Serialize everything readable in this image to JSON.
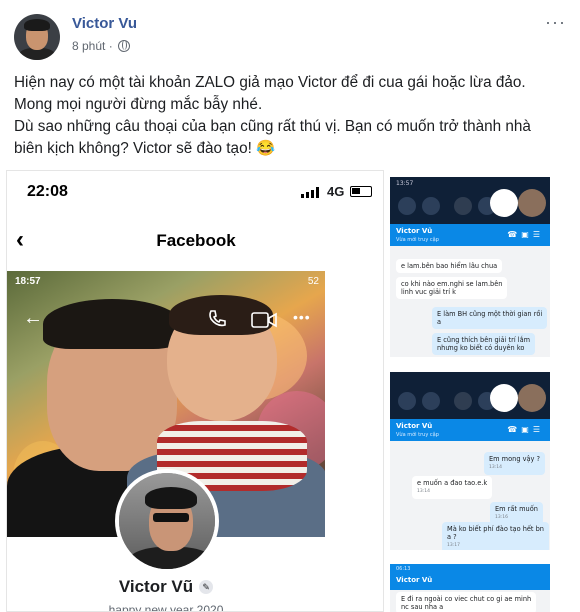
{
  "post": {
    "author": "Victor Vu",
    "time": "8 phút ·",
    "more": "···",
    "text_lines": [
      "Hiện nay có một tài khoản ZALO giả mạo Victor để đi cua gái hoặc lừa đảo.",
      "Mong mọi người đừng mắc bẫy nhé.",
      "Dù sao những câu thoại của bạn cũng rất thú vị. Bạn có muốn trở thành nhà",
      "biên kịch không? Victor sẽ đào tạo! 😂"
    ]
  },
  "phone": {
    "time": "22:08",
    "network": "4G",
    "title": "Facebook",
    "photo_status_time": "18:57",
    "photo_status_right": "52",
    "profile_name": "Victor Vũ",
    "bio": "happy new year 2020"
  },
  "zalo1": {
    "status": "13:57",
    "contact": "Victor Vũ",
    "sub": "Vừa mới truy cập",
    "messages": [
      {
        "dir": "in",
        "text": "e lam.bên bao hiểm lâu chua"
      },
      {
        "dir": "in",
        "text": "co khi nào em.nghi se lam.bên\nlinh vuc giải trí k"
      },
      {
        "dir": "out",
        "text": "E làm BH cũng một thời gian rồi\na"
      },
      {
        "dir": "out",
        "text": "E cũng thích bên giải trí lắm\nnhưng ko biết có duyên ko"
      }
    ]
  },
  "zalo2": {
    "contact": "Victor Vũ",
    "sub": "Vừa mới truy cập",
    "messages": [
      {
        "dir": "out",
        "text": "Em mong vậy ?",
        "time": "13:14"
      },
      {
        "dir": "in",
        "text": "e muốn a  đao tao.e.k",
        "time": "13:14"
      },
      {
        "dir": "out",
        "text": "Em rất muốn",
        "time": "13:16"
      },
      {
        "dir": "out",
        "text": "Mà ko biết phí đào tạo hết bn\na ?",
        "time": "13:17"
      }
    ]
  },
  "zalo3": {
    "status": "06:13",
    "contact": "Victor Vũ",
    "message": "E đi ra ngoài co viec chut co gi ae minh\nnc sau nha a"
  }
}
